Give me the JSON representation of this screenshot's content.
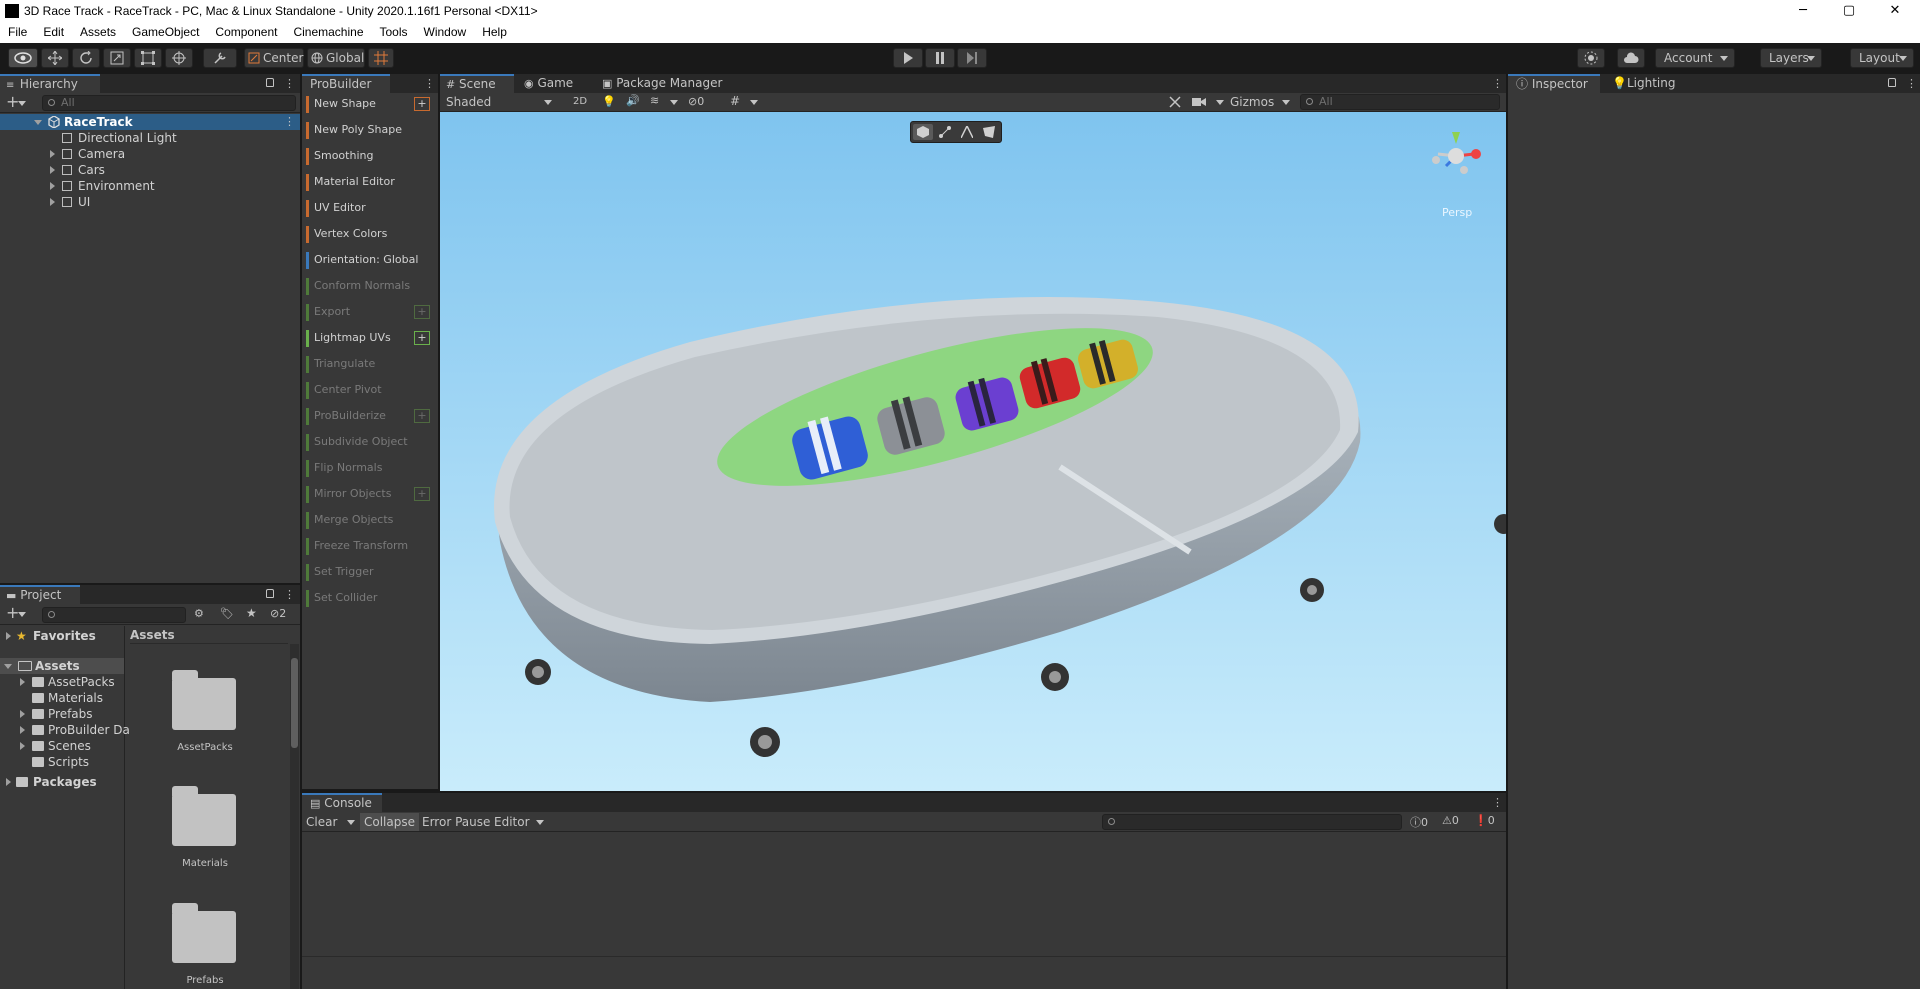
{
  "window": {
    "title": "3D Race Track - RaceTrack - PC, Mac & Linux Standalone - Unity 2020.1.16f1 Personal <DX11>",
    "controls": [
      "─",
      "▢",
      "✕"
    ]
  },
  "menu": [
    "File",
    "Edit",
    "Assets",
    "GameObject",
    "Component",
    "Cinemachine",
    "Tools",
    "Window",
    "Help"
  ],
  "toolbar": {
    "pivot_mode": "Center",
    "pivot_rotation": "Global",
    "account": "Account",
    "layers": "Layers",
    "layout": "Layout"
  },
  "hierarchy": {
    "tab": "Hierarchy",
    "search_placeholder": "All",
    "scene": "RaceTrack",
    "items": [
      "Directional Light",
      "Camera",
      "Cars",
      "Environment",
      "UI"
    ]
  },
  "probuilder": {
    "tab": "ProBuilder",
    "items": [
      {
        "label": "New Shape",
        "color": "#c86a2f",
        "plus": true,
        "enabled": true
      },
      {
        "label": "New Poly Shape",
        "color": "#c86a2f",
        "plus": false,
        "enabled": true
      },
      {
        "label": "Smoothing",
        "color": "#c86a2f",
        "plus": false,
        "enabled": true
      },
      {
        "label": "Material Editor",
        "color": "#c86a2f",
        "plus": false,
        "enabled": true
      },
      {
        "label": "UV Editor",
        "color": "#c86a2f",
        "plus": false,
        "enabled": true
      },
      {
        "label": "Vertex Colors",
        "color": "#c86a2f",
        "plus": false,
        "enabled": true
      },
      {
        "label": "Orientation: Global",
        "color": "#3a79bb",
        "plus": false,
        "enabled": true
      },
      {
        "label": "Conform Normals",
        "color": "#4f7a3a",
        "plus": false,
        "enabled": false
      },
      {
        "label": "Export",
        "color": "#4f7a3a",
        "plus": true,
        "enabled": false
      },
      {
        "label": "Lightmap UVs",
        "color": "#6ab04c",
        "plus": true,
        "enabled": true
      },
      {
        "label": "Triangulate",
        "color": "#4f7a3a",
        "plus": false,
        "enabled": false
      },
      {
        "label": "Center Pivot",
        "color": "#4f7a3a",
        "plus": false,
        "enabled": false
      },
      {
        "label": "ProBuilderize",
        "color": "#4f7a3a",
        "plus": true,
        "enabled": false
      },
      {
        "label": "Subdivide Object",
        "color": "#4f7a3a",
        "plus": false,
        "enabled": false
      },
      {
        "label": "Flip Normals",
        "color": "#4f7a3a",
        "plus": false,
        "enabled": false
      },
      {
        "label": "Mirror Objects",
        "color": "#4f7a3a",
        "plus": true,
        "enabled": false
      },
      {
        "label": "Merge Objects",
        "color": "#4f7a3a",
        "plus": false,
        "enabled": false
      },
      {
        "label": "Freeze Transform",
        "color": "#4f7a3a",
        "plus": false,
        "enabled": false
      },
      {
        "label": "Set Trigger",
        "color": "#4f7a3a",
        "plus": false,
        "enabled": false
      },
      {
        "label": "Set Collider",
        "color": "#4f7a3a",
        "plus": false,
        "enabled": false
      }
    ]
  },
  "scene": {
    "tabs": [
      "Scene",
      "Game",
      "Package Manager"
    ],
    "shading": "Shaded",
    "mode_2d": "2D",
    "hidden_count": "0",
    "gizmos": "Gizmos",
    "search_placeholder": "All",
    "persp": "Persp"
  },
  "inspector": {
    "tabs": [
      "Inspector",
      "Lighting"
    ]
  },
  "project": {
    "tab": "Project",
    "hidden_count": "2",
    "favorites": "Favorites",
    "assets_root": "Assets",
    "asset_folders": [
      "AssetPacks",
      "Materials",
      "Prefabs",
      "ProBuilder Da",
      "Scenes",
      "Scripts"
    ],
    "packages": "Packages",
    "breadcrumb": "Assets",
    "grid": [
      "AssetPacks",
      "Materials",
      "Prefabs"
    ]
  },
  "console": {
    "tab": "Console",
    "clear": "Clear",
    "collapse": "Collapse",
    "error_pause": "Error Pause",
    "editor": "Editor",
    "counts": {
      "log": "0",
      "warn": "0",
      "error": "0"
    }
  }
}
